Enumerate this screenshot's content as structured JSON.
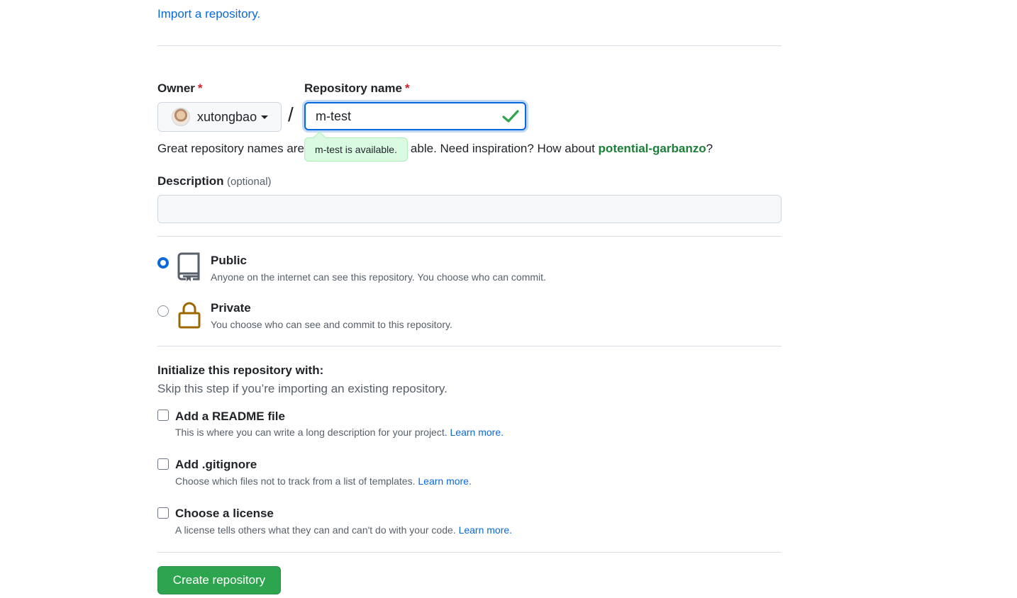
{
  "import": {
    "link": "Import a repository."
  },
  "owner": {
    "label": "Owner",
    "required_mark": "*",
    "value": "xutongbao"
  },
  "slash": "/",
  "repo_name": {
    "label": "Repository name",
    "required_mark": "*",
    "value": "m-test",
    "tooltip": "m-test is available."
  },
  "hint": {
    "prefix": "Great repository names are",
    "suffix": "able. Need inspiration? How about ",
    "suggestion": "potential-garbanzo",
    "end": "?"
  },
  "description": {
    "label": "Description",
    "optional": "(optional)",
    "value": ""
  },
  "visibility": {
    "public": {
      "title": "Public",
      "desc": "Anyone on the internet can see this repository. You choose who can commit.",
      "selected": true
    },
    "private": {
      "title": "Private",
      "desc": "You choose who can see and commit to this repository.",
      "selected": false
    }
  },
  "init": {
    "heading": "Initialize this repository with:",
    "subheading": "Skip this step if you’re importing an existing repository.",
    "readme": {
      "title": "Add a README file",
      "desc": "This is where you can write a long description for your project.",
      "link": "Learn more."
    },
    "gitignore": {
      "title": "Add .gitignore",
      "desc": "Choose which files not to track from a list of templates.",
      "link": "Learn more."
    },
    "license": {
      "title": "Choose a license",
      "desc": "A license tells others what they can and can't do with your code.",
      "link": "Learn more."
    }
  },
  "create_button": "Create repository",
  "colors": {
    "accent": "#0969da",
    "success": "#2da44e",
    "suggestion": "#1a7f37",
    "danger": "#cf222e",
    "private_icon": "#9a6700"
  }
}
